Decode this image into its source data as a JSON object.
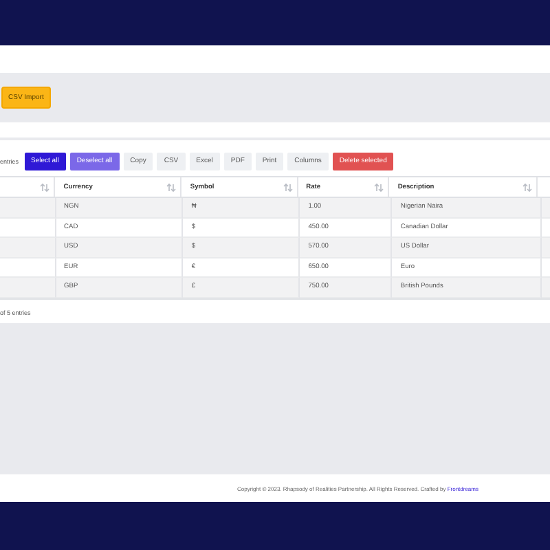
{
  "toolbar": {
    "import_button": "CSV Import"
  },
  "table_controls": {
    "entries_label": "entries",
    "buttons": [
      {
        "label": "Select all",
        "kind": "primary"
      },
      {
        "label": "Deselect all",
        "kind": "secondary"
      },
      {
        "label": "Copy",
        "kind": "plain"
      },
      {
        "label": "CSV",
        "kind": "plain"
      },
      {
        "label": "Excel",
        "kind": "plain"
      },
      {
        "label": "PDF",
        "kind": "plain"
      },
      {
        "label": "Print",
        "kind": "plain"
      },
      {
        "label": "Columns",
        "kind": "plain"
      },
      {
        "label": "Delete selected",
        "kind": "danger"
      }
    ]
  },
  "table": {
    "columns": [
      "",
      "Currency",
      "Symbol",
      "Rate",
      "Description"
    ],
    "rows": [
      [
        "",
        "NGN",
        "₦",
        "1.00",
        "Nigerian Naira"
      ],
      [
        "",
        "CAD",
        "$",
        "450.00",
        "Canadian Dollar"
      ],
      [
        "",
        "USD",
        "$",
        "570.00",
        "US Dollar"
      ],
      [
        "",
        "EUR",
        "€",
        "650.00",
        "Euro"
      ],
      [
        "",
        "GBP",
        "£",
        "750.00",
        "British Pounds"
      ]
    ]
  },
  "table_info": "of 5 entries",
  "footer": {
    "text": "Copyright © 2023. Rhapsody of Realities Partnership. All Rights Reserved. Crafted by",
    "link": "Frontdreams"
  }
}
